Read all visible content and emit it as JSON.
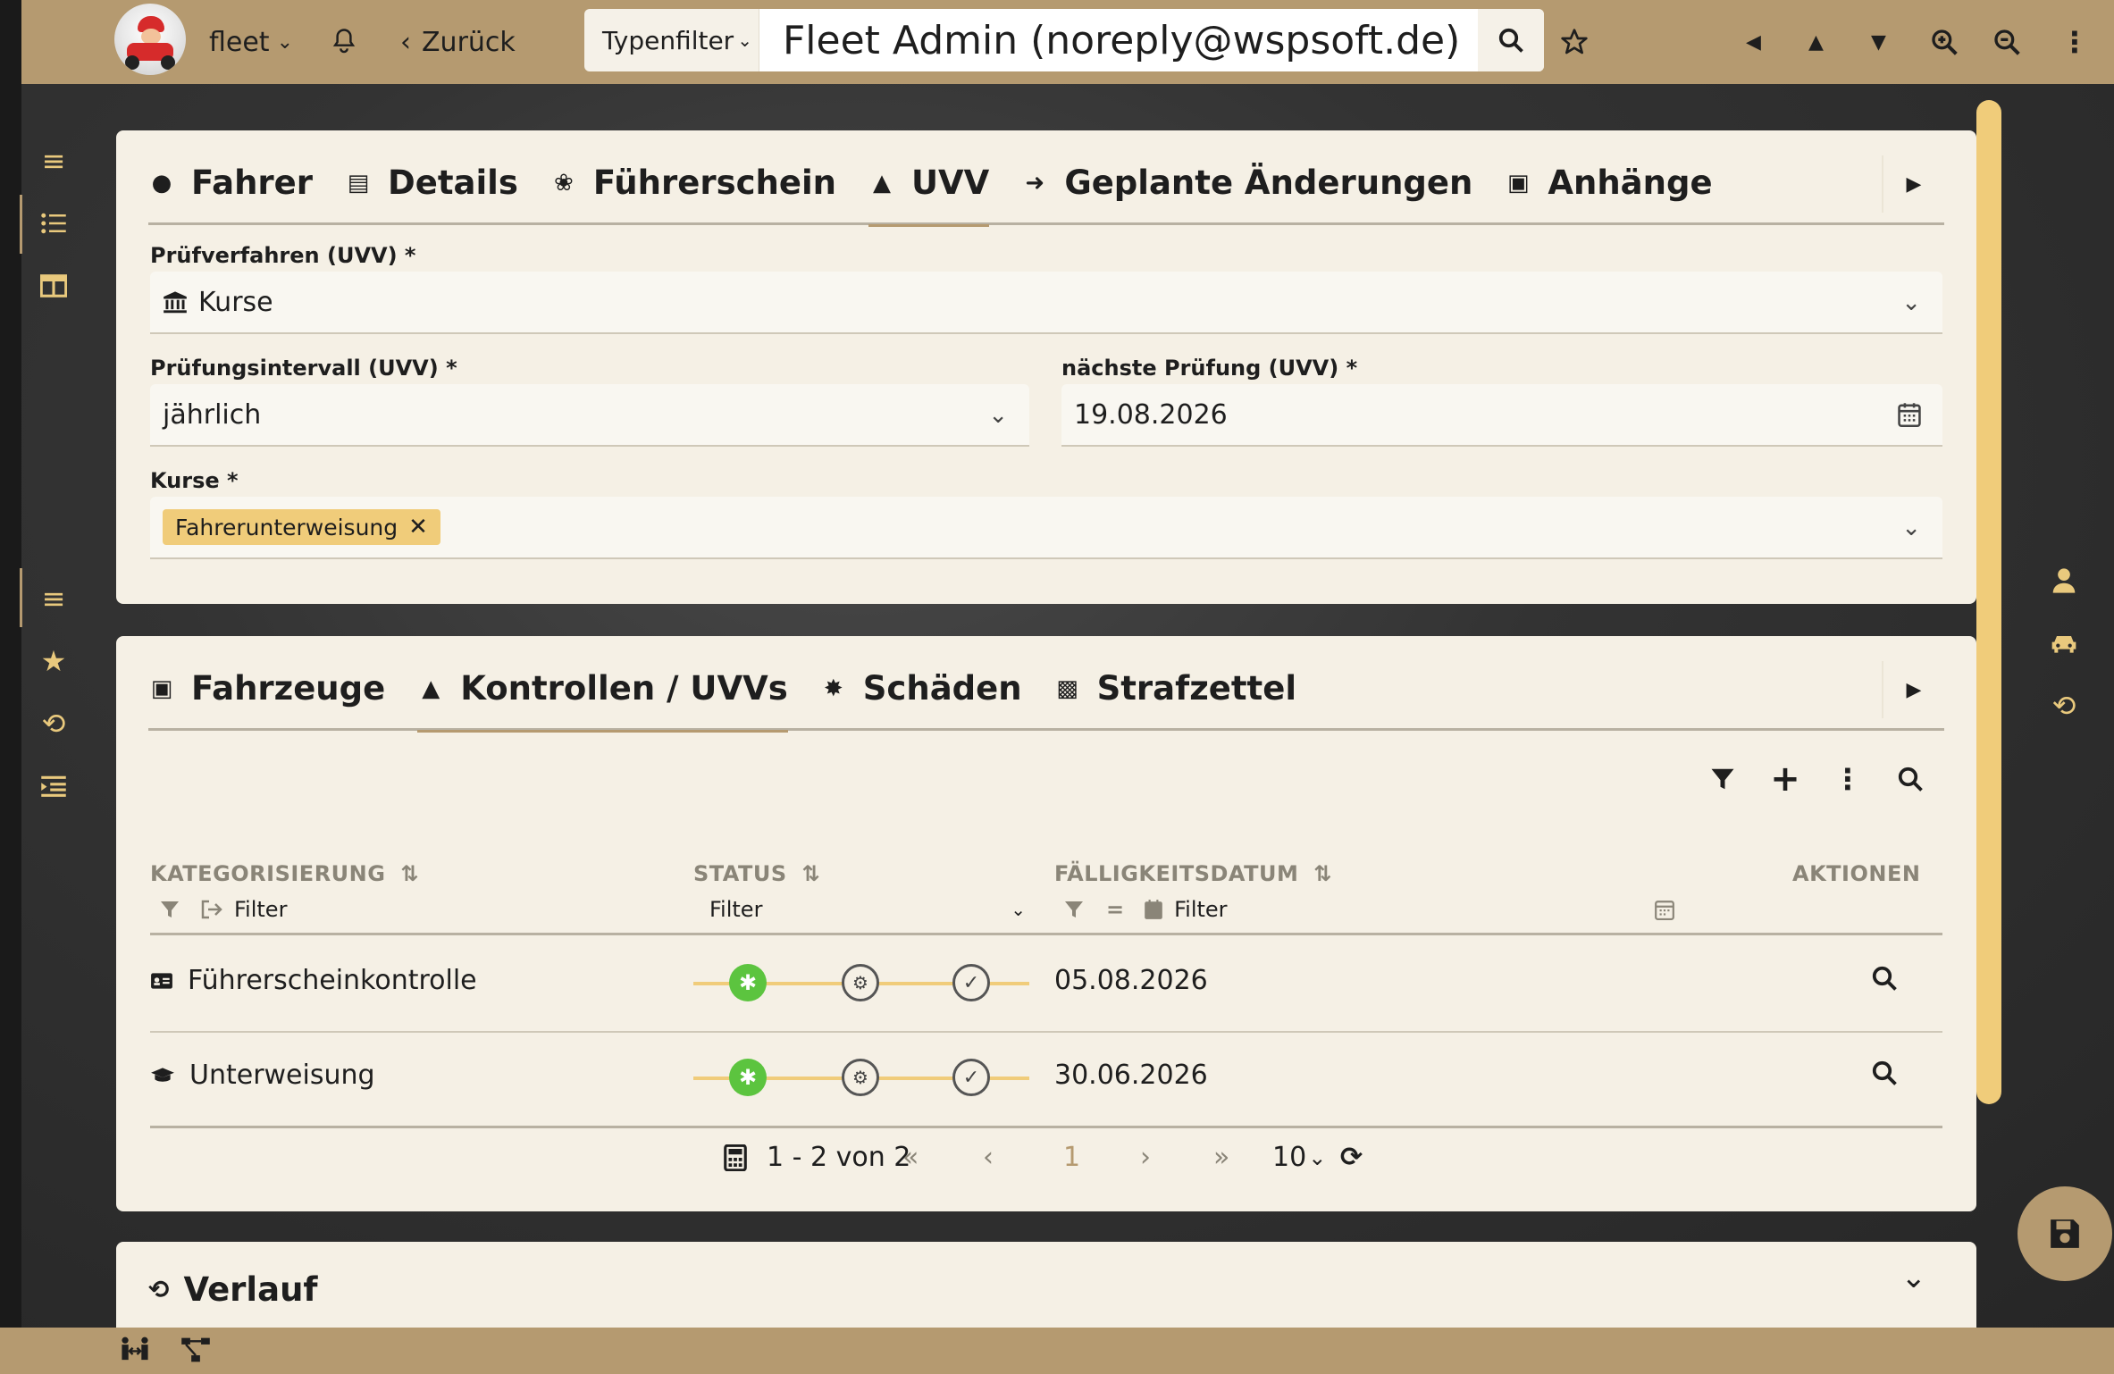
{
  "topbar": {
    "app_label": "fleet",
    "back_label": "Zurück",
    "type_filter": "Typenfilter",
    "search_value": "Fleet Admin (noreply@wspsoft.de)"
  },
  "form_panel": {
    "tabs": [
      {
        "label": "Fahrer"
      },
      {
        "label": "Details"
      },
      {
        "label": "Führerschein"
      },
      {
        "label": "UVV"
      },
      {
        "label": "Geplante Änderungen"
      },
      {
        "label": "Anhänge"
      }
    ],
    "active_tab": "UVV",
    "pruefverfahren": {
      "label": "Prüfverfahren (UVV) *",
      "value": "Kurse"
    },
    "intervall": {
      "label": "Prüfungsintervall (UVV) *",
      "value": "jährlich"
    },
    "naechste": {
      "label": "nächste Prüfung (UVV) *",
      "value": "19.08.2026"
    },
    "kurse": {
      "label": "Kurse *",
      "chips": [
        "Fahrerunterweisung"
      ]
    }
  },
  "list_panel": {
    "tabs": [
      {
        "label": "Fahrzeuge"
      },
      {
        "label": "Kontrollen / UVVs"
      },
      {
        "label": "Schäden"
      },
      {
        "label": "Strafzettel"
      }
    ],
    "active_tab": "Kontrollen / UVVs",
    "columns": {
      "kategorisierung": "KATEGORISIERUNG",
      "status": "STATUS",
      "faelligkeit": "FÄLLIGKEITSDATUM",
      "aktionen": "AKTIONEN"
    },
    "filter_placeholder": "Filter",
    "rows": [
      {
        "kategorie": "Führerscheinkontrolle",
        "datum": "05.08.2026"
      },
      {
        "kategorie": "Unterweisung",
        "datum": "30.06.2026"
      }
    ],
    "pager": {
      "range": "1 - 2 von 2",
      "current_page": "1",
      "page_size": "10"
    }
  },
  "verlauf_panel": {
    "title": "Verlauf"
  },
  "colors": {
    "brand": "#b59a70",
    "accent": "#f0cc7a",
    "status_active": "#5cc43f",
    "panel_bg": "#f5f0e5"
  }
}
